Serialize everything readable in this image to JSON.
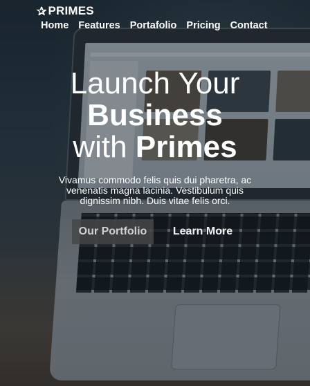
{
  "brand": {
    "icon": "star-icon",
    "name": "PRIMES"
  },
  "nav": {
    "items": [
      {
        "label": "Home"
      },
      {
        "label": "Features"
      },
      {
        "label": "Portafolio"
      },
      {
        "label": "Pricing"
      },
      {
        "label": "Contact"
      }
    ]
  },
  "hero": {
    "headline": {
      "line1": "Launch Your",
      "line2": "Business",
      "line3_light": "with",
      "line3_bold": "Primes"
    },
    "lead": "Vivamus commodo felis quis dui pharetra, ac venenatis magna lacinia. Vestibulum quis dignissim nibh. Duis vitae felis orci.",
    "buttons": {
      "portfolio_label": "Our Portfolio",
      "learn_more_label": "Learn More"
    }
  },
  "colors": {
    "text": "#ffffff",
    "button_bg": "#464646"
  }
}
